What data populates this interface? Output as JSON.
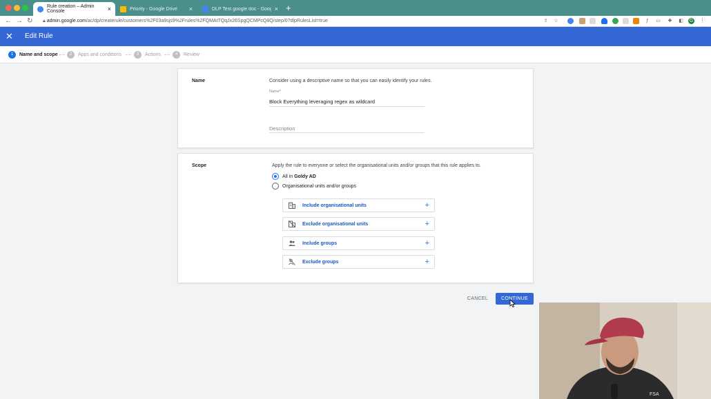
{
  "browser": {
    "tabs": [
      {
        "title": "Rule creation – Admin Console",
        "active": true,
        "favicon_color": "#4285f4"
      },
      {
        "title": "Priority - Google Drive",
        "active": false,
        "favicon_color": "#fbbc04"
      },
      {
        "title": "DLP Test google doc - Google",
        "active": false,
        "favicon_color": "#4285f4"
      }
    ],
    "url_host": "admin.google.com",
    "url_path": "/ac/dp/createrule/customers%2F03a9sjs9%2Frules%2FQMAtTQqJx26SpgQCMPcQ8Q/step/0?dlpRulesList=true",
    "profile_initial": "G"
  },
  "appbar": {
    "title": "Edit Rule",
    "background": "#3367d6"
  },
  "stepper": {
    "steps": [
      {
        "num": "1",
        "label": "Name and scope",
        "active": true
      },
      {
        "num": "2",
        "label": "Apps and conditions",
        "active": false
      },
      {
        "num": "3",
        "label": "Actions",
        "active": false
      },
      {
        "num": "4",
        "label": "Review",
        "active": false
      }
    ]
  },
  "name_section": {
    "label": "Name",
    "hint": "Consider using a descriptive name so that you can easily identify your rules.",
    "name_field_label": "Name*",
    "name_field_value": "Block Everything leveraging regex as wildcard",
    "description_placeholder": "Description"
  },
  "scope_section": {
    "label": "Scope",
    "hint": "Apply the rule to everyone or select the organisational units and/or groups that this rule applies to.",
    "radio_all_prefix": "All in",
    "radio_all_org": "Goldy AD",
    "radio_all_selected": true,
    "radio_units_label": "Organisational units and/or groups",
    "options": [
      {
        "label": "Include organisational units",
        "icon": "building-icon"
      },
      {
        "label": "Exclude organisational units",
        "icon": "building-off-icon"
      },
      {
        "label": "Include groups",
        "icon": "group-icon"
      },
      {
        "label": "Exclude groups",
        "icon": "group-off-icon"
      }
    ]
  },
  "actions": {
    "cancel_label": "CANCEL",
    "continue_label": "CONTINUE"
  }
}
